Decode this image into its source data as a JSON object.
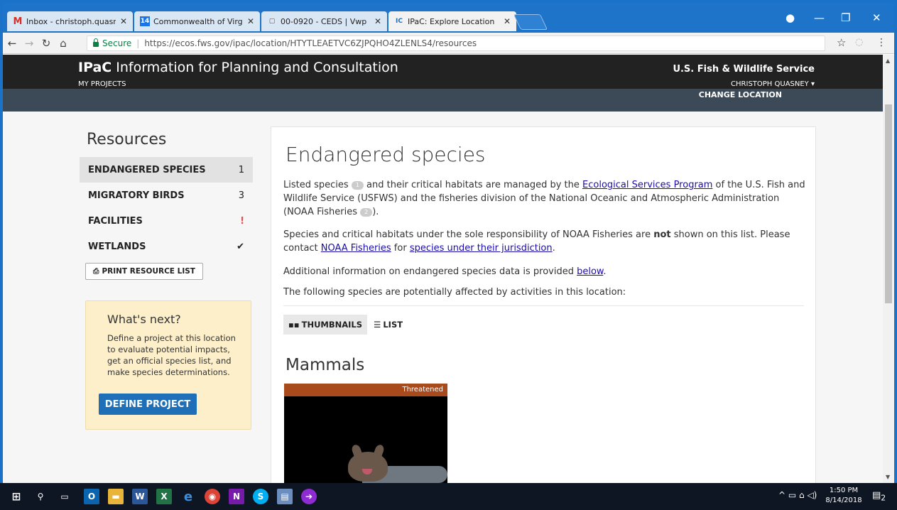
{
  "tabs": [
    {
      "title": "Inbox - christoph.quasney",
      "fav": "M",
      "favColor": "#d93025",
      "favBg": "#ffffff"
    },
    {
      "title": "Commonwealth of Virgin",
      "fav": "14",
      "favColor": "#ffffff",
      "favBg": "#1a73e8"
    },
    {
      "title": "00-0920 - CEDS | Vwp",
      "fav": "▢",
      "favColor": "#555555",
      "favBg": "transparent"
    },
    {
      "title": "IPaC: Explore Location",
      "fav": "IC",
      "favColor": "#1f6fb8",
      "favBg": "transparent"
    }
  ],
  "toolbar": {
    "secure_label": "Secure",
    "url": "https://ecos.fws.gov/ipac/location/HTYTLEAETVC6ZJPQHO4ZLENLS4/resources"
  },
  "header": {
    "brand_bold": "IPaC",
    "brand_rest": " Information for Planning and Consultation",
    "my_projects": "MY PROJECTS",
    "agency": "U.S. Fish & Wildlife Service",
    "user": "CHRISTOPH QUASNEY ▾",
    "change_location": "CHANGE LOCATION"
  },
  "sidebar": {
    "title": "Resources",
    "items": [
      {
        "label": "ENDANGERED SPECIES",
        "value": "1"
      },
      {
        "label": "MIGRATORY BIRDS",
        "value": "3"
      },
      {
        "label": "FACILITIES",
        "value": "!"
      },
      {
        "label": "WETLANDS",
        "value": "✔"
      }
    ],
    "print_label": "PRINT RESOURCE LIST"
  },
  "next": {
    "title": "What's next?",
    "body": "Define a project at this location to evaluate potential impacts, get an official species list, and make species determinations.",
    "button": "DEFINE PROJECT"
  },
  "main": {
    "title": "Endangered species",
    "p1_a": "Listed species ",
    "p1_badge1": "1",
    "p1_b": " and their critical habitats are managed by the ",
    "p1_link": "Ecological Services Program",
    "p1_c": " of the U.S. Fish and Wildlife Service (USFWS) and the fisheries division of the National Oceanic and Atmospheric Administration (NOAA Fisheries ",
    "p1_badge2": "2",
    "p1_d": ").",
    "p2_a": "Species and critical habitats under the sole responsibility of NOAA Fisheries are ",
    "p2_bold": "not",
    "p2_b": " shown on this list. Please contact ",
    "p2_link1": "NOAA Fisheries",
    "p2_c": " for ",
    "p2_link2": "species under their jurisdiction",
    "p2_d": ".",
    "p3_a": "Additional information on endangered species data is provided ",
    "p3_link": "below",
    "p3_b": ".",
    "p4": "The following species are potentially affected by activities in this location:",
    "view_thumbnails": "THUMBNAILS",
    "view_list": "LIST",
    "section": "Mammals",
    "species_status": "Threatened"
  },
  "taskbar": {
    "time": "1:50 PM",
    "date": "8/14/2018",
    "notif_count": "2"
  }
}
